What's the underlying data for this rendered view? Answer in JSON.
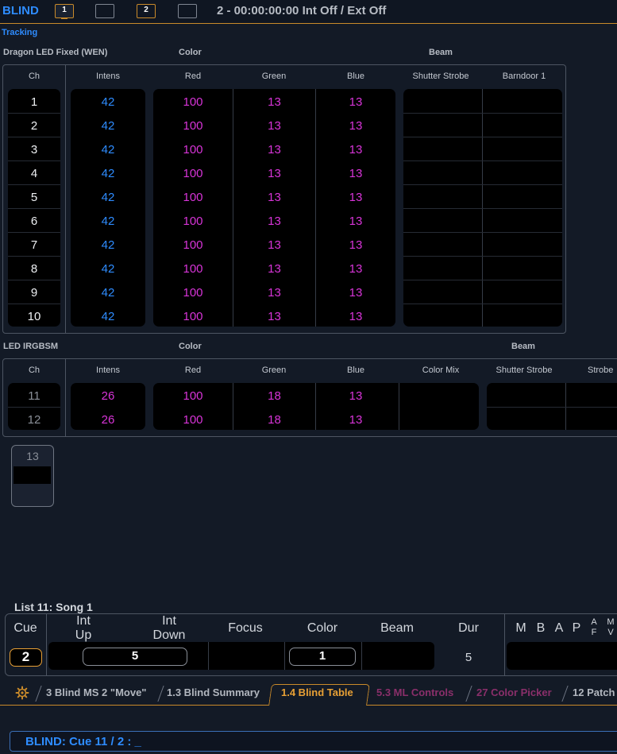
{
  "topbar": {
    "mode": "BLIND",
    "monitor_1": "1",
    "monitor_2": "2",
    "status": "2 - 00:00:00:00  Int Off / Ext Off"
  },
  "tracking_label": "Tracking",
  "group1": {
    "fixture": "Dragon LED Fixed (WEN)",
    "color_group": "Color",
    "beam_group": "Beam",
    "headers": [
      "Ch",
      "Intens",
      "Red",
      "Green",
      "Blue",
      "Shutter Strobe",
      "Barndoor 1"
    ],
    "rows": [
      {
        "ch": "1",
        "intens": "42",
        "red": "100",
        "green": "13",
        "blue": "13"
      },
      {
        "ch": "2",
        "intens": "42",
        "red": "100",
        "green": "13",
        "blue": "13"
      },
      {
        "ch": "3",
        "intens": "42",
        "red": "100",
        "green": "13",
        "blue": "13"
      },
      {
        "ch": "4",
        "intens": "42",
        "red": "100",
        "green": "13",
        "blue": "13"
      },
      {
        "ch": "5",
        "intens": "42",
        "red": "100",
        "green": "13",
        "blue": "13"
      },
      {
        "ch": "6",
        "intens": "42",
        "red": "100",
        "green": "13",
        "blue": "13"
      },
      {
        "ch": "7",
        "intens": "42",
        "red": "100",
        "green": "13",
        "blue": "13"
      },
      {
        "ch": "8",
        "intens": "42",
        "red": "100",
        "green": "13",
        "blue": "13"
      },
      {
        "ch": "9",
        "intens": "42",
        "red": "100",
        "green": "13",
        "blue": "13"
      },
      {
        "ch": "10",
        "intens": "42",
        "red": "100",
        "green": "13",
        "blue": "13"
      }
    ]
  },
  "group2": {
    "fixture": "LED IRGBSM",
    "color_group": "Color",
    "beam_group": "Beam",
    "headers": [
      "Ch",
      "Intens",
      "Red",
      "Green",
      "Blue",
      "Color Mix",
      "Shutter Strobe",
      "Strobe"
    ],
    "rows": [
      {
        "ch": "11",
        "intens": "26",
        "red": "100",
        "green": "18",
        "blue": "13"
      },
      {
        "ch": "12",
        "intens": "26",
        "red": "100",
        "green": "18",
        "blue": "13"
      }
    ]
  },
  "group3": {
    "ch": "13"
  },
  "cuelist": {
    "title": "List 11: Song 1",
    "headers": {
      "cue": "Cue",
      "int_up_1": "Int",
      "int_up_2": "Up",
      "int_down_1": "Int",
      "int_down_2": "Down",
      "focus": "Focus",
      "color": "Color",
      "beam": "Beam",
      "dur": "Dur",
      "m": "M",
      "b": "B",
      "a": "A",
      "p": "P",
      "af_1": "A",
      "af_2": "F",
      "mv_1": "M",
      "mv_2": "V"
    },
    "cue": "2",
    "int_time": "5",
    "color_time": "1",
    "dur": "5"
  },
  "tabs": [
    {
      "label": "3 Blind MS 2 \"Move\"",
      "color": "#b2b7bf"
    },
    {
      "label": "1.3 Blind Summary",
      "color": "#b2b7bf"
    },
    {
      "label": "1.4 Blind Table",
      "color": "#e8a035"
    },
    {
      "label": "5.3 ML Controls",
      "color": "#8a2f6a"
    },
    {
      "label": "27 Color Picker",
      "color": "#8a2f6a"
    },
    {
      "label": "12 Patch",
      "color": "#b2b7bf"
    }
  ],
  "command_line": "BLIND: Cue  11 / 2 :  _",
  "colors": {
    "accent_blue": "#2e8cff",
    "accent_orange": "#c98a2a",
    "value_magenta": "#d834d8"
  }
}
